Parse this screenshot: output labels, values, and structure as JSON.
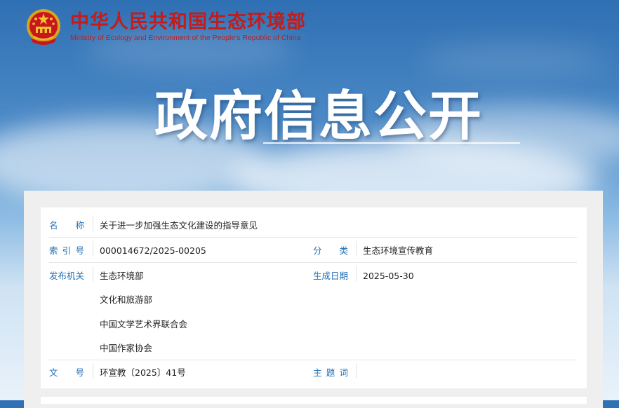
{
  "brand": {
    "name_cn": "中华人民共和国生态环境部",
    "name_en": "Ministry of Ecology and Environment of the People's Republic of China",
    "emblem_icon": "national-emblem-icon",
    "color": "#c41b1b"
  },
  "hero": {
    "title": "政府信息公开"
  },
  "info": {
    "label_color": "#1f6fb5",
    "name_label": [
      "名",
      "称"
    ],
    "name_value": "关于进一步加强生态文化建设的指导意见",
    "index_label": [
      "索",
      "引",
      "号"
    ],
    "index_value": "000014672/2025-00205",
    "category_label": [
      "分",
      "类"
    ],
    "category_value": "生态环境宣传教育",
    "publisher_label": "发布机关",
    "publishers": [
      "生态环境部",
      "文化和旅游部",
      "中国文学艺术界联合会",
      "中国作家协会"
    ],
    "date_label": "生成日期",
    "date_value": "2025-05-30",
    "doc_no_label": [
      "文",
      "号"
    ],
    "doc_no_value": "环宣教〔2025〕41号",
    "keywords_label": [
      "主",
      "题",
      "词"
    ],
    "keywords_value": ""
  }
}
